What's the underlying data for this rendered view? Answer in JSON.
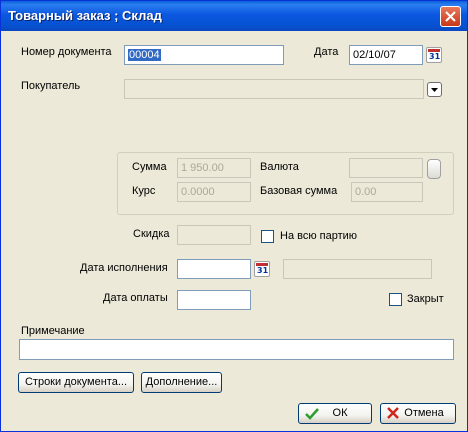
{
  "window": {
    "title": "Товарный заказ ; Склад"
  },
  "form": {
    "doc_number_label": "Номер документа",
    "doc_number_value": "00004",
    "date_label": "Дата",
    "date_value": "02/10/07",
    "buyer_label": "Покупатель",
    "buyer_value": "",
    "amount_label": "Сумма",
    "amount_value": "1 950.00",
    "currency_label": "Валюта",
    "currency_value": "",
    "rate_label": "Курс",
    "rate_value": "0.0000",
    "base_amount_label": "Базовая сумма",
    "base_amount_value": "0.00",
    "discount_label": "Скидка",
    "discount_value": "",
    "whole_batch_label": "На всю партию",
    "whole_batch_checked": false,
    "exec_date_label": "Дата исполнения",
    "exec_date_value": "",
    "exec_extra_value": "",
    "pay_date_label": "Дата оплаты",
    "pay_date_value": "",
    "closed_label": "Закрыт",
    "closed_checked": false,
    "note_label": "Примечание",
    "note_value": ""
  },
  "buttons": {
    "doc_lines_label": "Строки документа...",
    "extra_label": "Дополнение...",
    "ok_label": "ОК",
    "cancel_label": "Отмена"
  },
  "icons": {
    "calendar": "calendar-icon",
    "dropdown": "chevron-down-icon",
    "ok": "checkmark-icon",
    "cancel": "cross-icon",
    "close": "close-icon"
  },
  "colors": {
    "title_bar": "#0652d1",
    "selection": "#316ac5",
    "ok_check": "#2e9d2e",
    "cancel_cross": "#d0271d"
  }
}
